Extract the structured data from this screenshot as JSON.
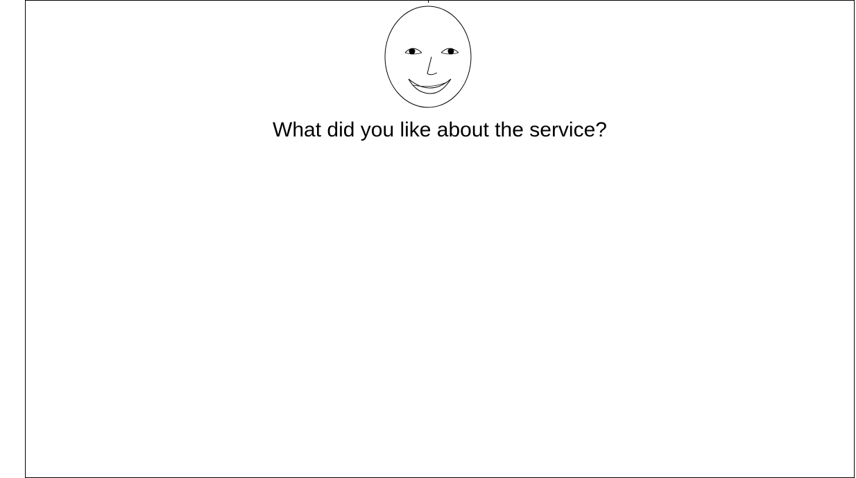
{
  "form": {
    "question": "What did you like about the service?",
    "face_icon": "smiley-face-icon",
    "answer": ""
  },
  "colors": {
    "border": "#000000",
    "background": "#ffffff",
    "text": "#000000"
  }
}
